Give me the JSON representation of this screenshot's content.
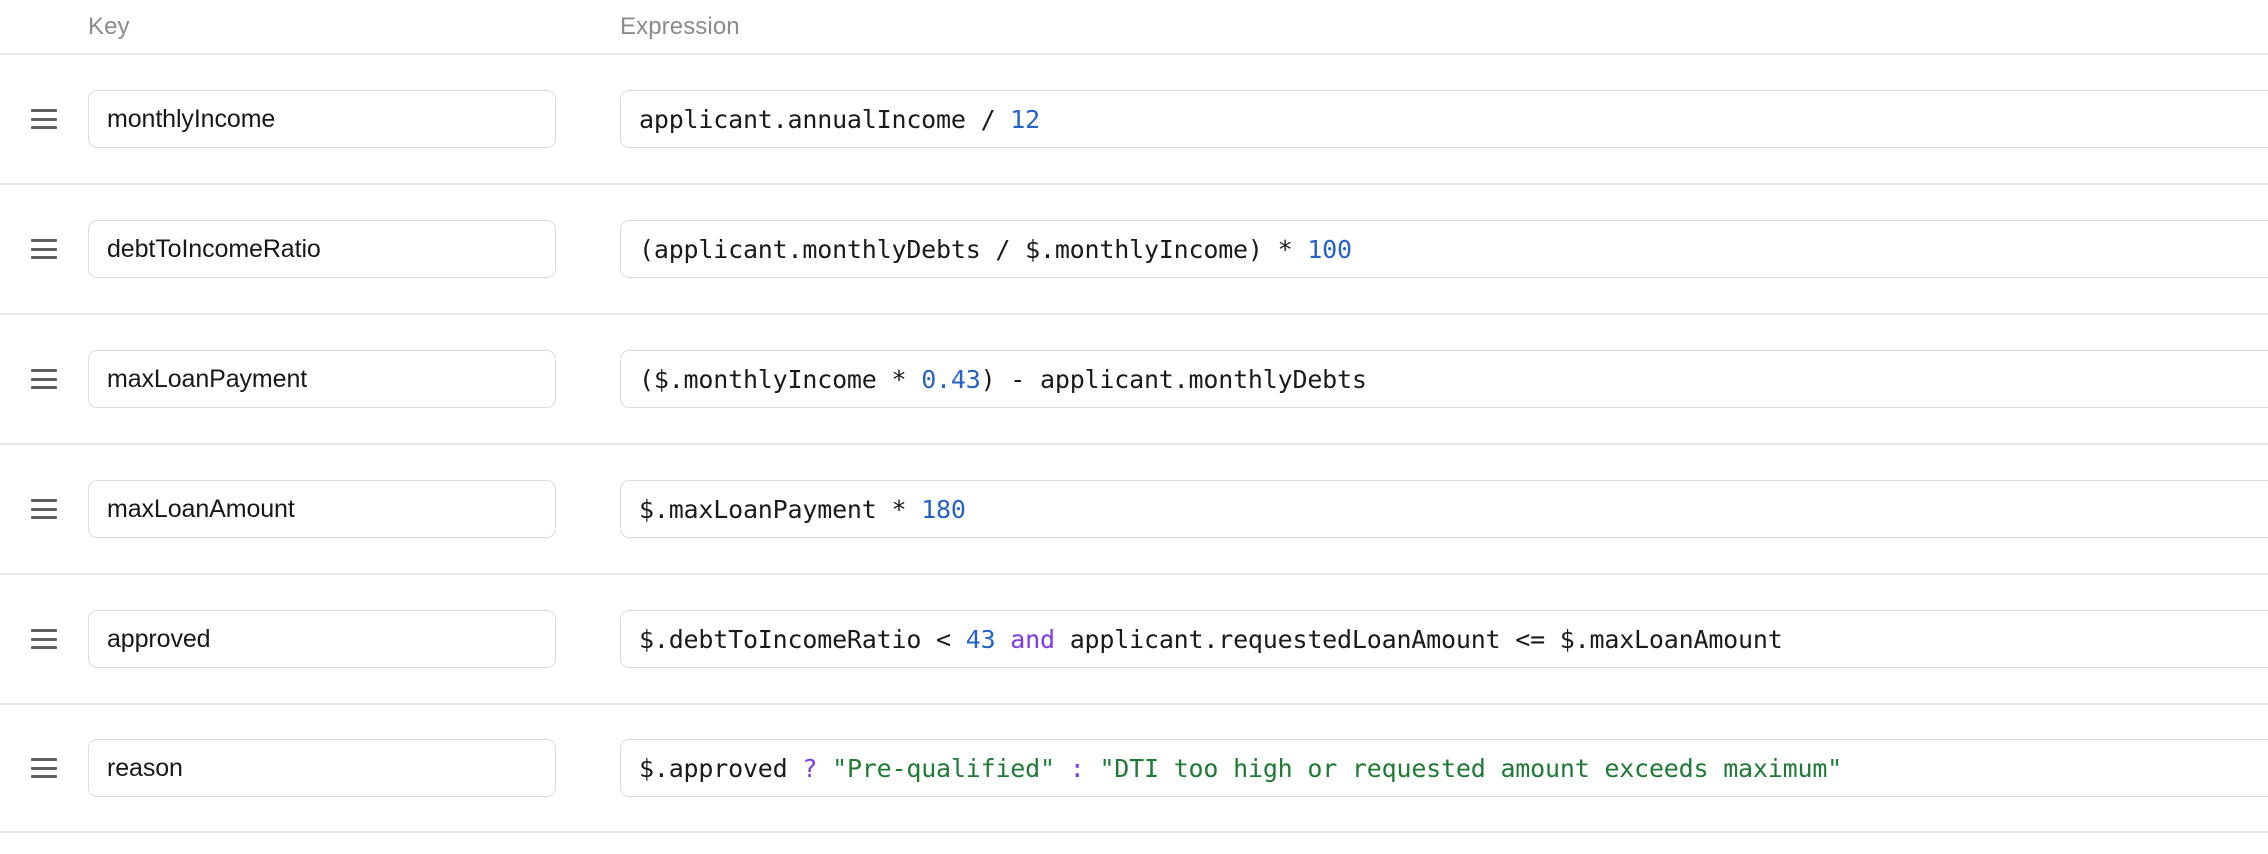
{
  "table": {
    "columns": {
      "key_header": "Key",
      "expression_header": "Expression"
    },
    "colors": {
      "number": "#2563c8",
      "string": "#1f7a35",
      "keyword": "#7c3aed",
      "text": "#1a1a1e",
      "delete_icon": "#ef5350",
      "border": "#e6e6e8",
      "header_text": "#8b8b8f"
    },
    "icons": {
      "drag_handle": "drag-handle-icon",
      "delete": "trash-icon"
    },
    "rows": [
      {
        "key": "monthlyIncome",
        "expression": "applicant.annualIncome / 12",
        "tokens": [
          {
            "t": "applicant.annualIncome / ",
            "k": "op"
          },
          {
            "t": "12",
            "k": "num"
          }
        ]
      },
      {
        "key": "debtToIncomeRatio",
        "expression": "(applicant.monthlyDebts / $.monthlyIncome) * 100",
        "tokens": [
          {
            "t": "(applicant.monthlyDebts / $.monthlyIncome) * ",
            "k": "op"
          },
          {
            "t": "100",
            "k": "num"
          }
        ]
      },
      {
        "key": "maxLoanPayment",
        "expression": "($.monthlyIncome * 0.43) - applicant.monthlyDebts",
        "tokens": [
          {
            "t": "($.monthlyIncome * ",
            "k": "op"
          },
          {
            "t": "0.43",
            "k": "num"
          },
          {
            "t": ") - applicant.monthlyDebts",
            "k": "op"
          }
        ]
      },
      {
        "key": "maxLoanAmount",
        "expression": "$.maxLoanPayment * 180",
        "tokens": [
          {
            "t": "$.maxLoanPayment * ",
            "k": "op"
          },
          {
            "t": "180",
            "k": "num"
          }
        ]
      },
      {
        "key": "approved",
        "expression": "$.debtToIncomeRatio < 43 and applicant.requestedLoanAmount <= $.maxLoanAmount",
        "tokens": [
          {
            "t": "$.debtToIncomeRatio < ",
            "k": "op"
          },
          {
            "t": "43",
            "k": "num"
          },
          {
            "t": " ",
            "k": "op"
          },
          {
            "t": "and",
            "k": "kw"
          },
          {
            "t": " applicant.requestedLoanAmount <= $.maxLoanAmount",
            "k": "op"
          }
        ]
      },
      {
        "key": "reason",
        "expression": "$.approved ? \"Pre-qualified\" : \"DTI too high or requested amount exceeds maximum\"",
        "tokens": [
          {
            "t": "$.approved ",
            "k": "op"
          },
          {
            "t": "?",
            "k": "kw"
          },
          {
            "t": " ",
            "k": "op"
          },
          {
            "t": "\"Pre-qualified\"",
            "k": "str"
          },
          {
            "t": " ",
            "k": "op"
          },
          {
            "t": ":",
            "k": "kw"
          },
          {
            "t": " ",
            "k": "op"
          },
          {
            "t": "\"DTI too high or requested amount exceeds maximum\"",
            "k": "str"
          }
        ]
      }
    ]
  }
}
